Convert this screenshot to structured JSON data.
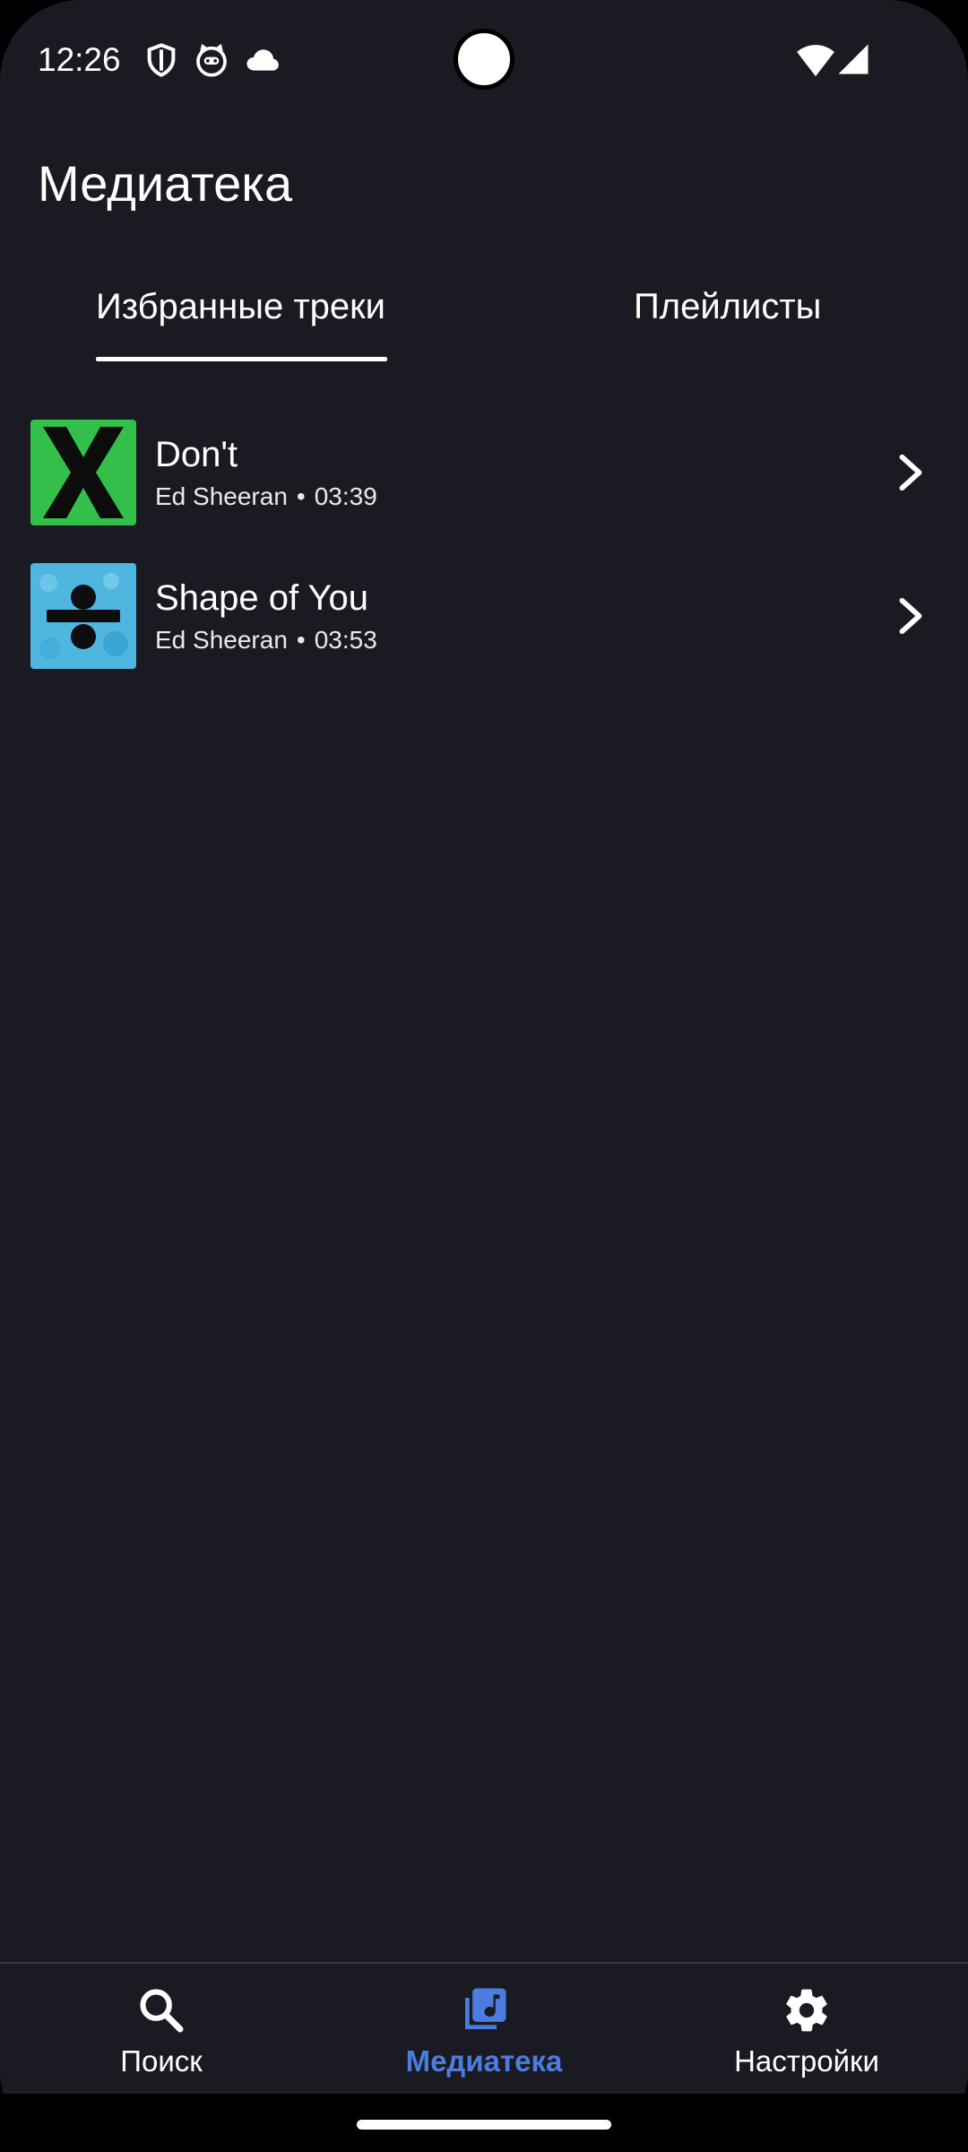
{
  "status_bar": {
    "time": "12:26",
    "icons": [
      "shield-icon",
      "cat-face-icon",
      "cloud-icon",
      "wifi-icon",
      "cellular-signal-icon"
    ]
  },
  "header": {
    "title": "Медиатека"
  },
  "tabs": [
    {
      "label": "Избранные треки",
      "selected": true
    },
    {
      "label": "Плейлисты",
      "selected": false
    }
  ],
  "tracks": [
    {
      "title": "Don't",
      "artist": "Ed Sheeran",
      "dot": "•",
      "duration": "03:39",
      "art": "album-x-art"
    },
    {
      "title": "Shape of You",
      "artist": "Ed Sheeran",
      "dot": "•",
      "duration": "03:53",
      "art": "album-divide-art"
    }
  ],
  "bottom_nav": [
    {
      "label": "Поиск",
      "icon": "search-icon",
      "active": false
    },
    {
      "label": "Медиатека",
      "icon": "library-music-icon",
      "active": true
    },
    {
      "label": "Настройки",
      "icon": "gear-icon",
      "active": false
    }
  ],
  "colors": {
    "background": "#1a1b22",
    "accent": "#4c7dde",
    "text": "#ffffff",
    "album_x_green": "#32c04a",
    "album_divide_blue": "#4fb6e0"
  }
}
